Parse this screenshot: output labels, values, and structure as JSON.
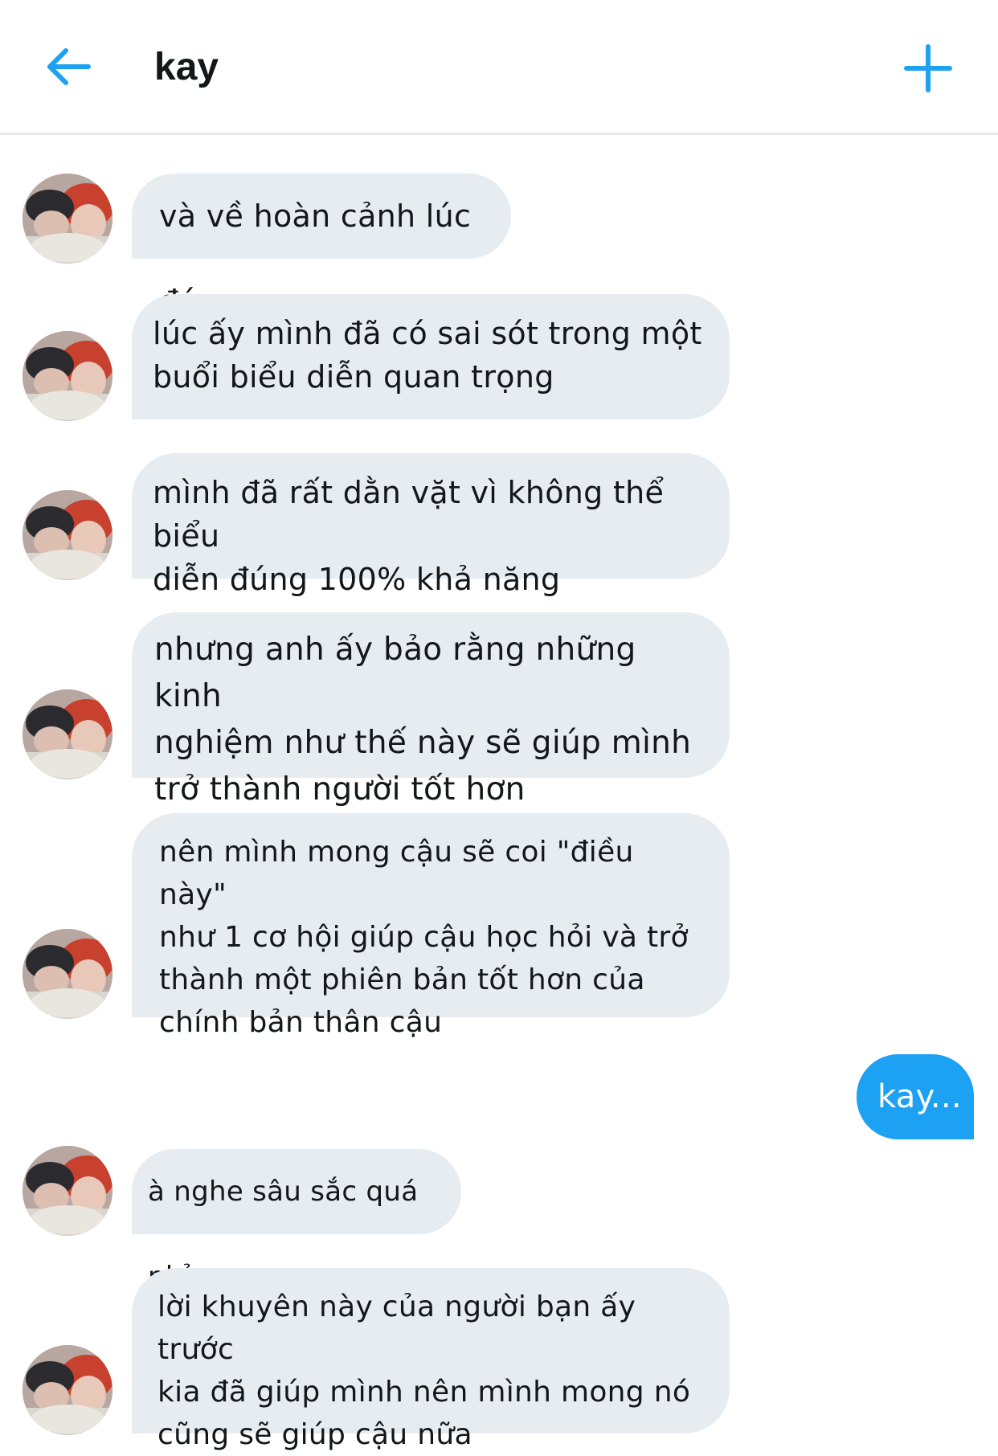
{
  "header": {
    "title": "kay",
    "back_icon": "arrow-left-icon",
    "new_icon": "plus-icon",
    "accent_color": "#1da1f2"
  },
  "messages": [
    {
      "side": "received",
      "text": "và về hoàn cảnh lúc đó"
    },
    {
      "side": "received",
      "text": "lúc ấy mình đã có sai sót trong một\nbuổi biểu diễn quan trọng"
    },
    {
      "side": "received",
      "text": "mình đã rất dằn vặt vì không thể biểu\ndiễn đúng 100% khả năng"
    },
    {
      "side": "received",
      "text": "nhưng anh ấy bảo rằng những kinh\nnghiệm như thế này sẽ giúp mình\ntrở thành người tốt hơn"
    },
    {
      "side": "received",
      "text": "nên mình mong cậu sẽ coi \"điều này\"\nnhư 1 cơ hội giúp cậu học hỏi và trở\nthành một phiên bản tốt hơn của\nchính bản thân cậu"
    },
    {
      "side": "sent",
      "text": "kay..."
    },
    {
      "side": "received",
      "text": "à nghe sâu sắc quá nhỉ"
    },
    {
      "side": "received",
      "text": "lời khuyên này của người bạn ấy trước\nkia đã giúp mình nên mình mong nó\ncũng sẽ giúp cậu nữa"
    }
  ]
}
